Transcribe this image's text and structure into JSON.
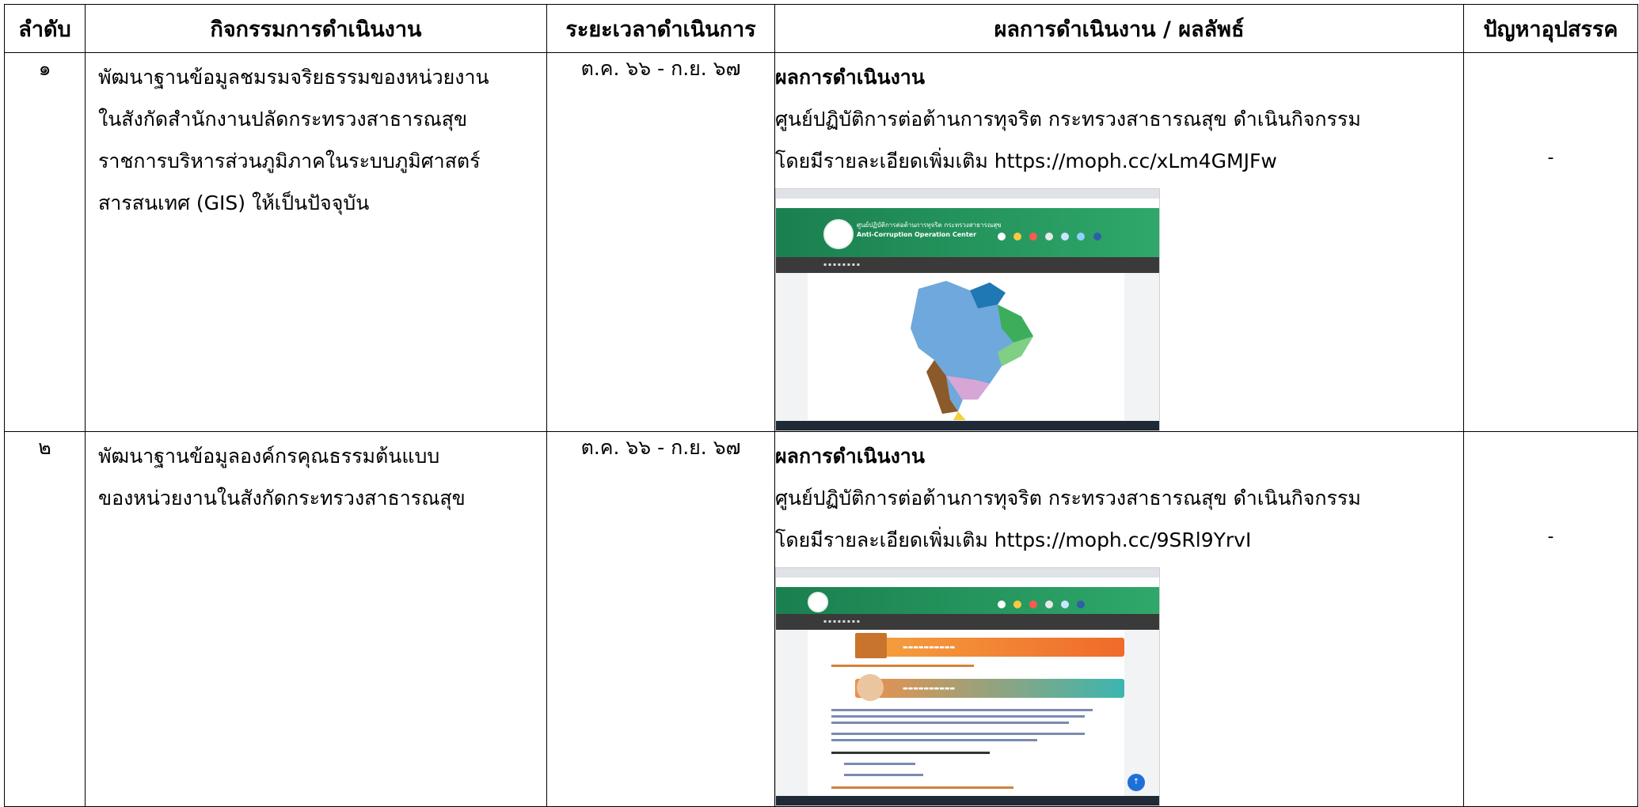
{
  "headers": {
    "no": "ลำดับ",
    "activity": "กิจกรรมการดำเนินงาน",
    "period": "ระยะเวลาดำเนินการ",
    "result": "ผลการดำเนินงาน / ผลลัพธ์",
    "problems": "ปัญหาอุปสรรค"
  },
  "rows": [
    {
      "no": "๑",
      "activity_lines": [
        "พัฒนาฐานข้อมูลชมรมจริยธรรมของหน่วยงาน",
        "ในสังกัดสำนักงานปลัดกระทรวงสาธารณสุข",
        "ราชการบริหารส่วนภูมิภาคในระบบภูมิศาสตร์",
        "สารสนเทศ (GIS) ให้เป็นปัจจุบัน"
      ],
      "period": "ต.ค. ๖๖ - ก.ย. ๖๗",
      "result_title": "ผลการดำเนินงาน",
      "result_lines": [
        "ศูนย์ปฏิบัติการต่อต้านการทุจริต กระทรวงสาธารณสุข ดำเนินกิจกรรม",
        "โดยมีรายละเอียดเพิ่มเติม https://moph.cc/xLm4GMJFw"
      ],
      "problems": "-",
      "screenshot": {
        "site_name_th": "ศูนย์ปฏิบัติการต่อต้านการทุจริต กระทรวงสาธารณสุข",
        "site_name_en": "Anti-Corruption Operation Center",
        "colors": {
          "header": "#1a7f4f",
          "nav": "#3a3a3a"
        },
        "icons": [
          "thailand-map-icon"
        ]
      }
    },
    {
      "no": "๒",
      "activity_lines": [
        "พัฒนาฐานข้อมูลองค์กรคุณธรรมต้นแบบ",
        "ของหน่วยงานในสังกัดกระทรวงสาธารณสุข"
      ],
      "period": "ต.ค. ๖๖ - ก.ย. ๖๗",
      "result_title": "ผลการดำเนินงาน",
      "result_lines": [
        "ศูนย์ปฏิบัติการต่อต้านการทุจริต กระทรวงสาธารณสุข ดำเนินกิจกรรม",
        "โดยมีรายละเอียดเพิ่มเติม https://moph.cc/9SRl9YrvI"
      ],
      "problems": "-",
      "screenshot": {
        "colors": {
          "banner1": "#f06a2a",
          "banner2": "#3bb6b0"
        },
        "icons": [
          "book-icon",
          "hands-icon",
          "scroll-top-icon"
        ]
      }
    }
  ]
}
